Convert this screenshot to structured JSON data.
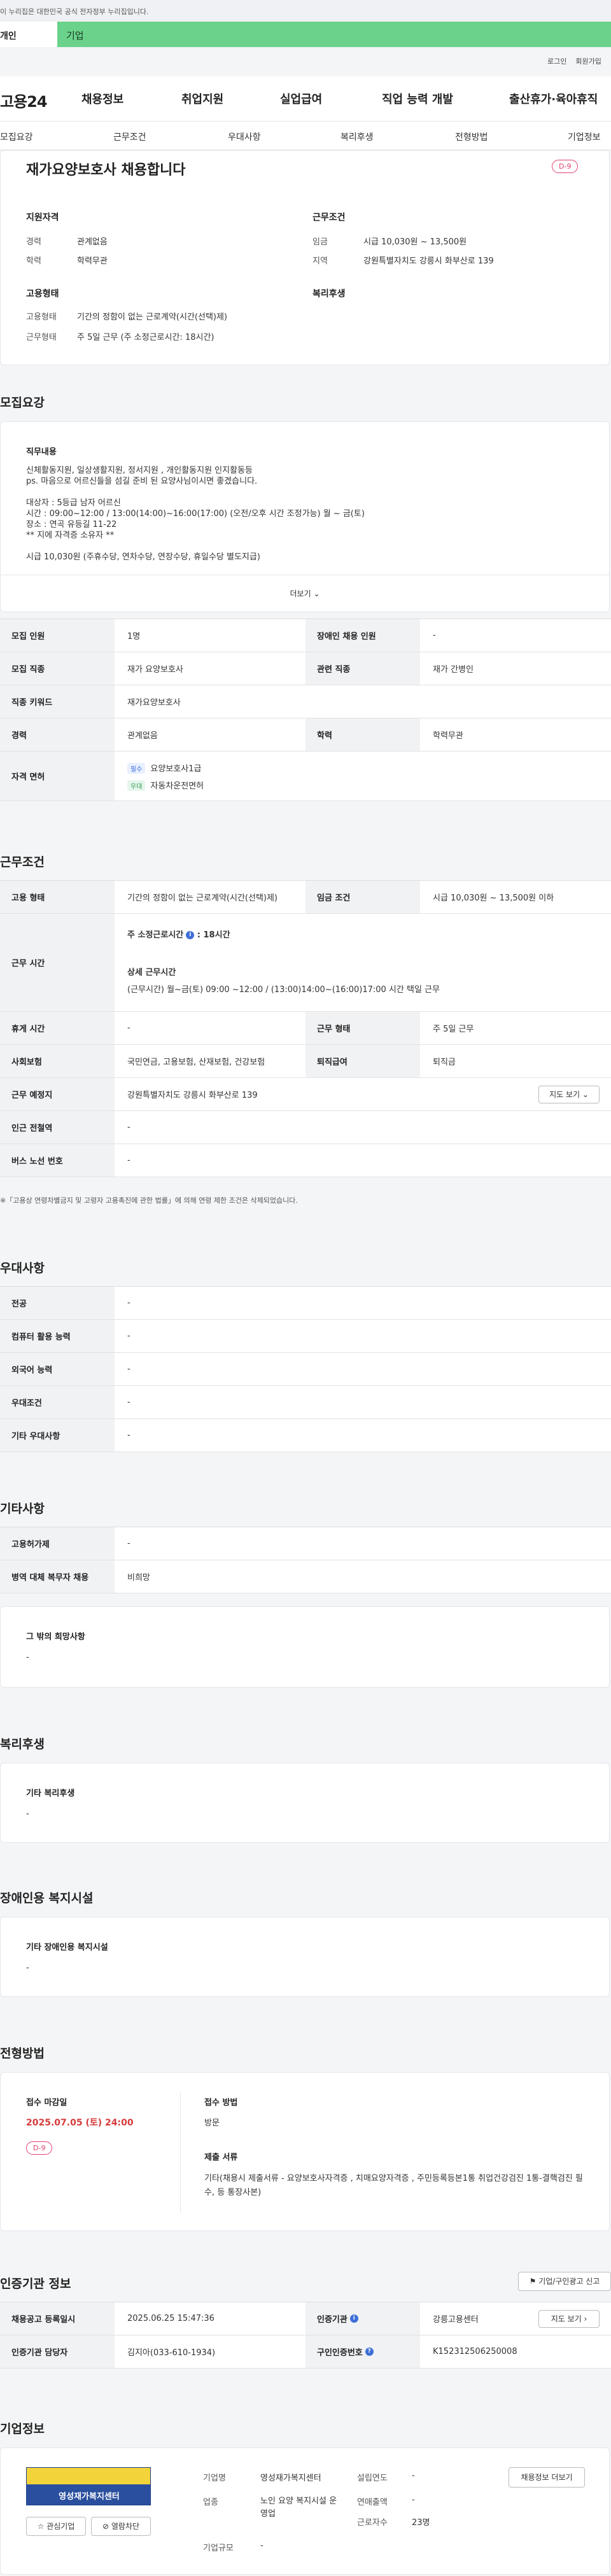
{
  "gov_notice": "이 누리집은 대한민국 공식 전자정부 누리집입니다.",
  "member_tabs": {
    "personal": "개인",
    "company": "기업"
  },
  "util": {
    "login": "로그인",
    "join": "회원가입"
  },
  "logo": "고용24",
  "gnb": [
    "채용정보",
    "취업지원",
    "실업급여",
    "직업 능력 개발",
    "출산휴가·육아휴직"
  ],
  "subnav": [
    "모집요강",
    "근무조건",
    "우대사항",
    "복리후생",
    "전형방법",
    "기업정보"
  ],
  "summary": {
    "title": "재가요양보호사 채용합니다",
    "dday": "D-9",
    "qual_heading": "지원자격",
    "cond_heading": "근무조건",
    "emp_heading": "고용형태",
    "welfare_heading": "복리후생",
    "career_k": "경력",
    "career_v": "관계없음",
    "edu_k": "학력",
    "edu_v": "학력무관",
    "wage_k": "임금",
    "wage_v": "시급 10,030원 ~ 13,500원",
    "region_k": "지역",
    "region_v": "강원특별자치도 강릉시 화부산로 139",
    "emptype_k": "고용형태",
    "emptype_v": "기간의 정함이 없는 근로계약(시간(선택)제)",
    "worktype_k": "근무형태",
    "worktype_v": "주 5일 근무 (주 소정근로시간: 18시간)"
  },
  "recruit": {
    "heading": "모집요강",
    "job_content_label": "직무내용",
    "job_content": "신체활동지원, 일상생활지원, 정서지원 , 개인활동지원  인지활동등\nps. 마음으로 어르신들을 섬길 준비 된 요양사님이시면 좋겠습니다.\n\n대상자 : 5등급 남자 어르신\n시간 : 09:00~12:00 / 13:00(14:00)~16:00(17:00)  (오전/오후 시간 조정가능)  월 ~ 금(토)\n장소 : 연곡 유등길 11-22\n ** 지에 자격증 소유자 **\n\n시급 10,030원 (주휴수당, 연차수당, 연장수당, 휴일수당 별도지급)",
    "more": "더보기",
    "table": {
      "headcount_k": "모집 인원",
      "headcount_v": "1명",
      "disabled_k": "장애인 채용 인원",
      "disabled_v": "-",
      "occupation_k": "모집 직종",
      "occupation_v": "재가 요양보호사",
      "related_k": "관련 직종",
      "related_v": "재가 간병인",
      "keyword_k": "직종 키워드",
      "keyword_v": "재가요양보호사",
      "career_k": "경력",
      "career_v": "관계없음",
      "edu_k": "학력",
      "edu_v": "학력무관",
      "license_k": "자격 면허",
      "license_req_badge": "필수",
      "license_req": "요양보호사1급",
      "license_pref_badge": "우대",
      "license_pref": "자동차운전면허"
    }
  },
  "conditions": {
    "heading": "근무조건",
    "emptype_k": "고용 형태",
    "emptype_v": "기간의 정함이 없는 근로계약(시간(선택)제)",
    "wage_k": "임금 조건",
    "wage_v": "시급 10,030원 ~ 13,500원 이하",
    "hours_k": "근무 시간",
    "hours_weekly_label": "주 소정근로시간",
    "hours_weekly_value": "18시간",
    "hours_detail_label": "상세 근무시간",
    "hours_detail": "(근무시간)    월~금(토) 09:00 ~12:00 / (13:00)14:00~(16:00)17:00 시간 택일 근무",
    "break_k": "휴게 시간",
    "break_v": "-",
    "workform_k": "근무 형태",
    "workform_v": "주 5일 근무",
    "insurance_k": "사회보험",
    "insurance_v": "국민연금, 고용보험, 산재보험, 건강보험",
    "severance_k": "퇴직급여",
    "severance_v": "퇴직금",
    "location_k": "근무 예정지",
    "location_v": "강원특별자치도 강릉시 화부산로 139",
    "map_button": "지도 보기",
    "subway_k": "인근 전철역",
    "subway_v": "-",
    "bus_k": "버스 노선 번호",
    "bus_v": "-",
    "footnote": "※「고용상 연령차별금지 및 고령자 고용촉진에 관한 법률」에 의해 연령 제한 조건은 삭제되었습니다."
  },
  "preference": {
    "heading": "우대사항",
    "rows": [
      {
        "k": "전공",
        "v": "-"
      },
      {
        "k": "컴퓨터 활용 능력",
        "v": "-"
      },
      {
        "k": "외국어 능력",
        "v": "-"
      },
      {
        "k": "우대조건",
        "v": "-"
      },
      {
        "k": "기타 우대사항",
        "v": "-"
      }
    ]
  },
  "etc": {
    "heading": "기타사항",
    "rows": [
      {
        "k": "고용허가제",
        "v": "-"
      },
      {
        "k": "병역 대체 복무자 채용",
        "v": "비희망"
      }
    ],
    "other_label": "그 밖의 희망사항",
    "other_value": "-"
  },
  "welfare": {
    "heading": "복리후생",
    "label": "기타 복리후생",
    "value": "-"
  },
  "disabled_facility": {
    "heading": "장애인용 복지시설",
    "label": "기타 장애인용 복지시설",
    "value": "-"
  },
  "selection": {
    "heading": "전형방법",
    "deadline_label": "접수 마감일",
    "deadline_value": "2025.07.05 (토) 24:00",
    "dday": "D-9",
    "method_label": "접수 방법",
    "method_value": "방문",
    "docs_label": "제출 서류",
    "docs_value": "기타(채용시 제출서류 - 요양보호사자격증 , 치매요양자격증 , 주민등록등본1통   취업건강검진 1통-결핵검진 필수,  등  통장사본)"
  },
  "agency": {
    "heading": "인증기관 정보",
    "print_button": "기업/구인광고 신고",
    "date_k": "채용공고 등록일시",
    "date_v": "2025.06.25 15:47:36",
    "org_k": "인증기관",
    "org_v": "강릉고용센터",
    "map_button": "지도 보기",
    "manager_k": "인증기관 담당자",
    "manager_v": "김지아(033-610-1934)",
    "num_k": "구인인증번호",
    "num_v": "K152312506250008"
  },
  "company": {
    "heading": "기업정보",
    "logo_text": "영성재가복지센터",
    "interest_button": "관심기업",
    "block_button": "열람차단",
    "name_k": "기업명",
    "name_v": "영성재가복지센터",
    "founded_k": "설립연도",
    "founded_v": "-",
    "industry_k": "업종",
    "industry_v": "노인 요양 복지시설 운영업",
    "sales_k": "연매출액",
    "sales_v": "-",
    "employees_k": "근로자수",
    "employees_v": "23명",
    "scale_k": "기업규모",
    "scale_v": "-",
    "jobs_button": "채용정보 더보기"
  }
}
